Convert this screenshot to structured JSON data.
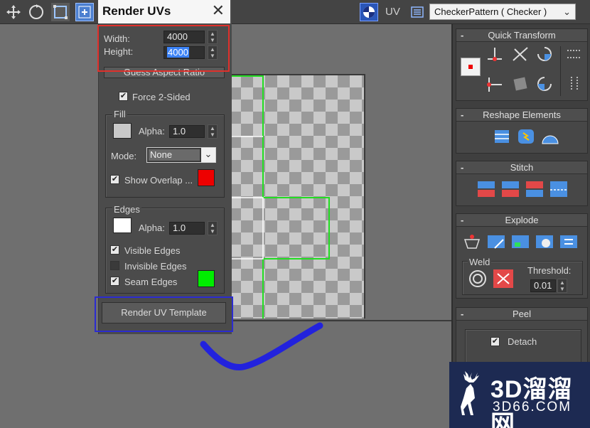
{
  "toolbar": {
    "uv_label": "UV",
    "checker_select": "CheckerPattern  ( Checker )"
  },
  "dialog": {
    "title": "Render UVs",
    "width_label": "Width:",
    "width_value": "4000",
    "height_label": "Height:",
    "height_value": "4000",
    "guess_aspect_button": "Guess Aspect Ratio",
    "force_2sided": "Force 2-Sided",
    "fill": {
      "group_label": "Fill",
      "alpha_label": "Alpha:",
      "alpha_value": "1.0",
      "mode_label": "Mode:",
      "mode_value": "None",
      "show_overlap": "Show Overlap ...",
      "swatch_color": "#c9c9c9",
      "overlap_color": "#ee0000"
    },
    "edges": {
      "group_label": "Edges",
      "alpha_label": "Alpha:",
      "alpha_value": "1.0",
      "visible_edges": "Visible Edges",
      "invisible_edges": "Invisible Edges",
      "seam_edges": "Seam Edges",
      "swatch_color": "#ffffff",
      "seam_color": "#00ee00"
    },
    "render_button": "Render UV Template"
  },
  "panel": {
    "quick_transform": "Quick Transform",
    "reshape_elements": "Reshape Elements",
    "stitch": "Stitch",
    "explode": "Explode",
    "weld_label": "Weld",
    "threshold_label": "Threshold:",
    "threshold_value": "0.01",
    "peel": "Peel",
    "detach_label": "Detach",
    "collapse_symbol": "-"
  },
  "watermark": {
    "title": "3D溜溜网",
    "sub": "3D66.COM"
  }
}
